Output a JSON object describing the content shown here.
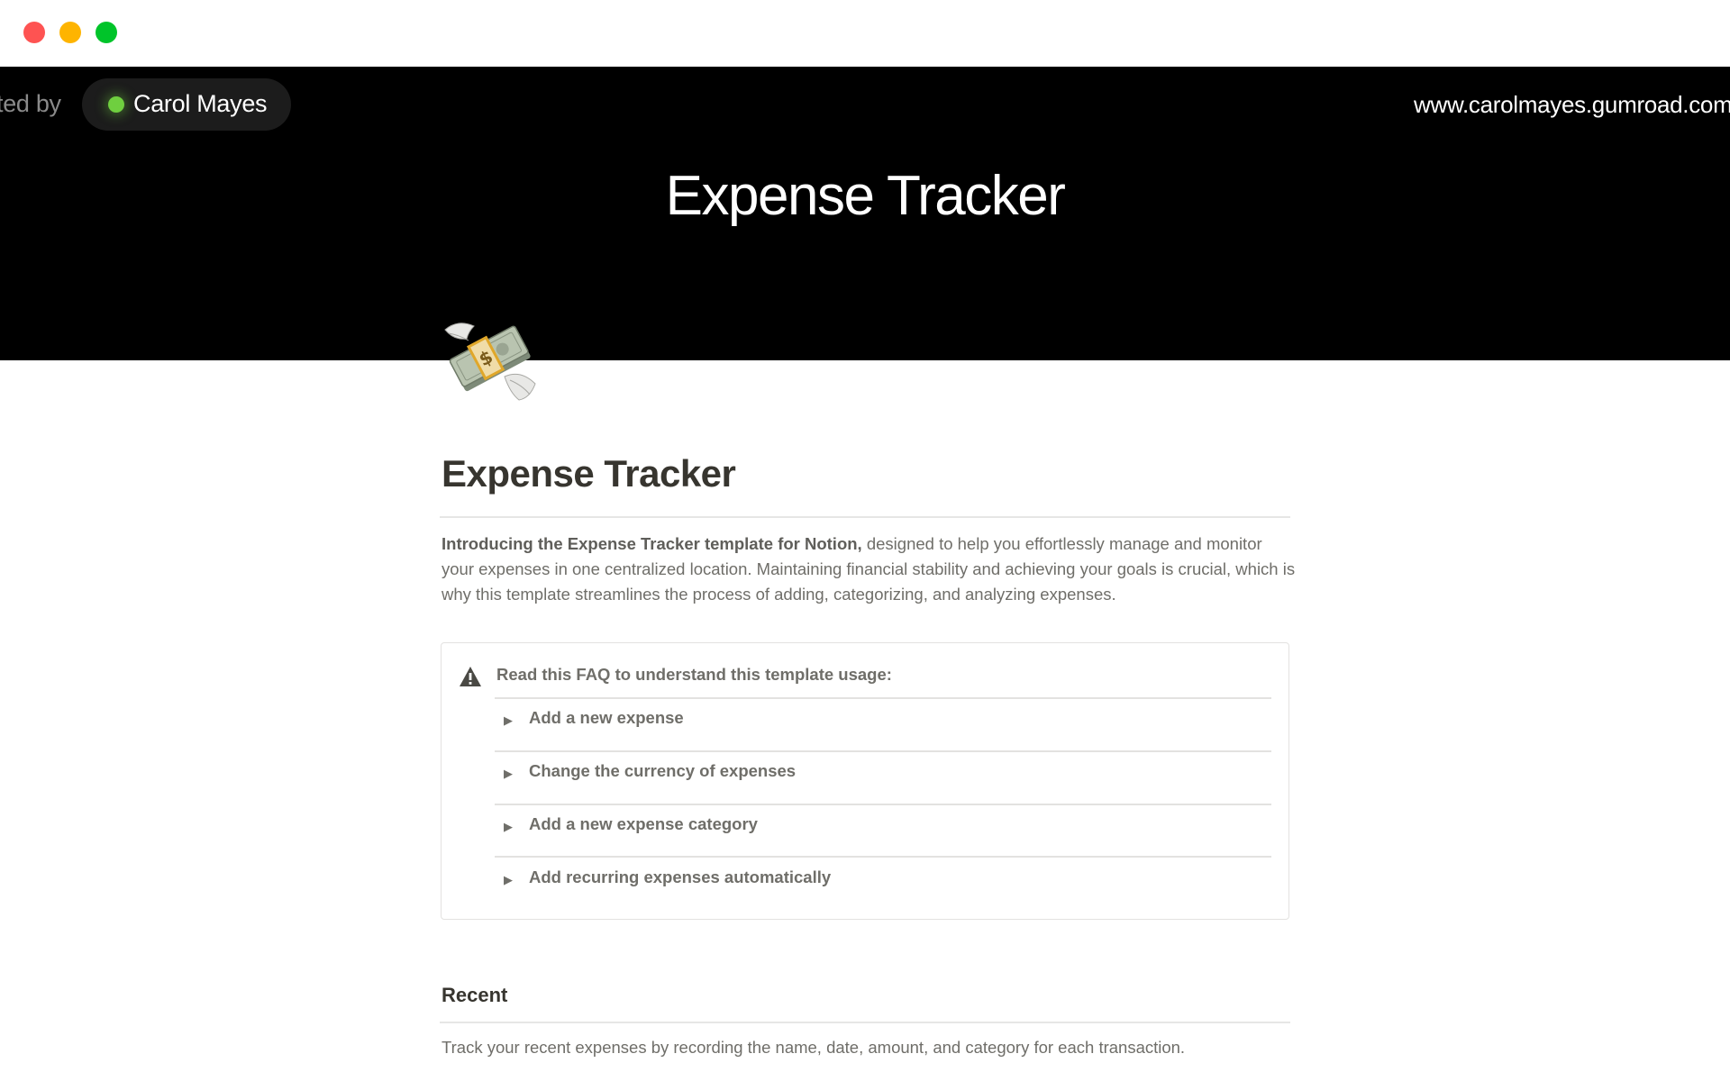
{
  "window": {
    "controls": [
      "close",
      "minimize",
      "maximize"
    ]
  },
  "banner": {
    "created_by_label": "ted by",
    "author_name": "Carol Mayes",
    "author_status_color": "#6fcf3f",
    "website": "www.carolmayes.gumroad.com",
    "title": "Expense Tracker"
  },
  "page": {
    "icon": "money-with-wings-emoji",
    "title": "Expense Tracker",
    "intro_bold": "Introducing the Expense Tracker template for Notion,",
    "intro_rest": " designed to help you effortlessly manage and monitor your expenses in one centralized location. Maintaining financial stability and achieving your goals is crucial, which is why this template streamlines the process of adding, categorizing, and analyzing expenses.",
    "callout": {
      "icon": "warning-icon",
      "heading": "Read this FAQ to understand this template usage:",
      "toggles": [
        {
          "label": "Add a new expense"
        },
        {
          "label": "Change the currency of expenses"
        },
        {
          "label": "Add a new expense category"
        },
        {
          "label": "Add recurring expenses automatically"
        }
      ]
    },
    "recent": {
      "heading": "Recent",
      "description": "Track your recent expenses by recording the name, date, amount, and category for each transaction."
    }
  }
}
